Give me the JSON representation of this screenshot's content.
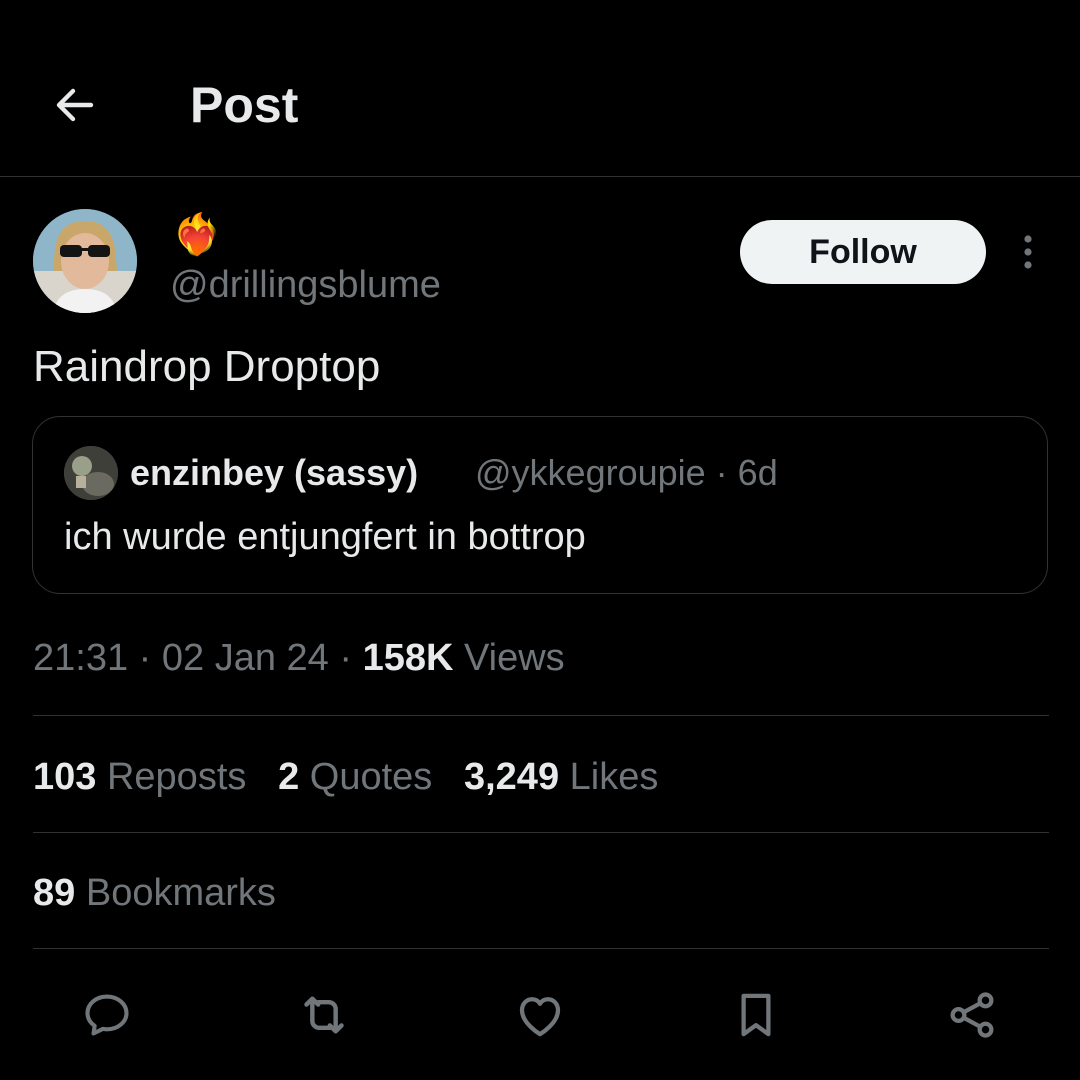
{
  "header": {
    "title": "Post",
    "back_icon": "arrow-left-icon"
  },
  "author": {
    "display_name": "❤️‍🔥",
    "handle": "@drillingsblume",
    "follow_label": "Follow"
  },
  "post": {
    "text": "Raindrop Droptop"
  },
  "quote": {
    "name": "enzinbey (sassy)",
    "handle": "@ykkegroupie",
    "separator": " · ",
    "age": "6d",
    "text": "ich wurde entjungfert in bottrop"
  },
  "meta": {
    "time": "21:31",
    "date": "02 Jan 24",
    "views_count": "158K",
    "views_label": "Views"
  },
  "stats": {
    "reposts_count": "103",
    "reposts_label": "Reposts",
    "quotes_count": "2",
    "quotes_label": "Quotes",
    "likes_count": "3,249",
    "likes_label": "Likes",
    "bookmarks_count": "89",
    "bookmarks_label": "Bookmarks"
  },
  "actions": [
    "reply-icon",
    "repost-icon",
    "like-icon",
    "bookmark-icon",
    "share-icon"
  ],
  "colors": {
    "background": "#000000",
    "text": "#e7e9ea",
    "secondary": "#71767b",
    "border": "#2f3336",
    "button": "#eff3f4"
  }
}
